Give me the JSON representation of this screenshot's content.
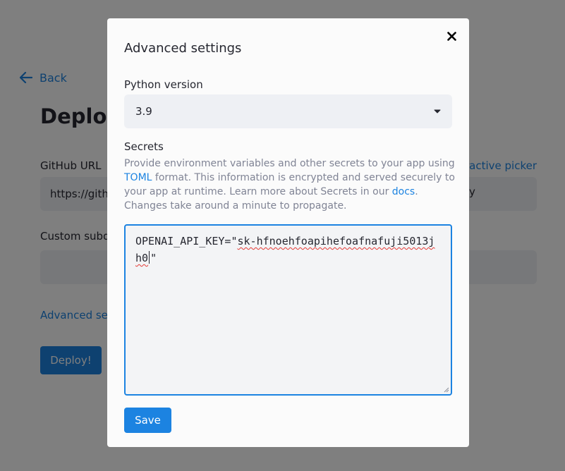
{
  "background": {
    "back_label": "Back",
    "title": "Deploy",
    "github_url": {
      "label": "GitHub URL",
      "value": "https://gith"
    },
    "interactive_picker_link": "eractive picker",
    "right_fragment": "y",
    "custom_subdomain": {
      "label": "Custom subd",
      "value": ""
    },
    "advanced_link": "Advanced set",
    "deploy_label": "Deploy!",
    "accent_color": "#1c83e1"
  },
  "modal": {
    "title": "Advanced settings",
    "close_icon": "close-icon",
    "python_version": {
      "label": "Python version",
      "selected": "3.9"
    },
    "secrets": {
      "label": "Secrets",
      "help": {
        "part1": "Provide environment variables and other secrets to your app using ",
        "toml_link": "TOML",
        "part2": " format. This information is encrypted and served securely to your app at runtime. Learn more about Secrets in our ",
        "docs_link": "docs",
        "part3": ". Changes take around a minute to propagate."
      },
      "value_prefix": "OPENAI_API_KEY=\"",
      "value_key": "sk-hfnoehfoapihefoafnafuji5013jh0",
      "value_suffix": "\""
    },
    "save_label": "Save"
  },
  "overlay_color": "rgba(0,0,0,0.5)"
}
